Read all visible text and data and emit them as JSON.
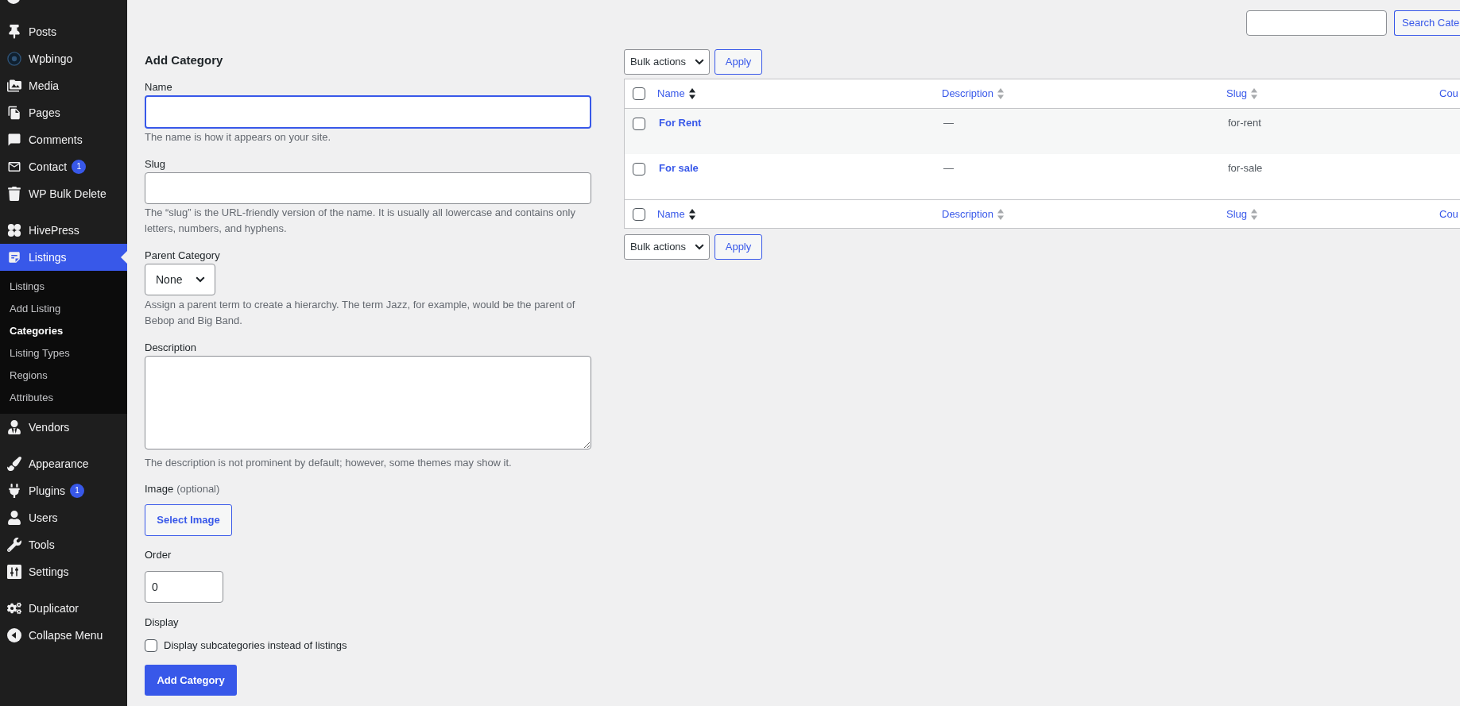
{
  "sidebar": {
    "sections": [
      {
        "items": [
          {
            "label": "Posts",
            "selected": false
          },
          {
            "label": "Wpbingo",
            "selected": false
          },
          {
            "label": "Media",
            "selected": false
          },
          {
            "label": "Pages",
            "selected": false
          },
          {
            "label": "Comments",
            "selected": false
          },
          {
            "label": "Contact",
            "selected": false,
            "badge": "1"
          },
          {
            "label": "WP Bulk Delete",
            "selected": false
          }
        ]
      },
      {
        "items": [
          {
            "label": "HivePress",
            "selected": false
          },
          {
            "label": "Listings",
            "selected": true,
            "children": [
              {
                "label": "Listings",
                "selected": false
              },
              {
                "label": "Add Listing",
                "selected": false
              },
              {
                "label": "Categories",
                "selected": true
              },
              {
                "label": "Listing Types",
                "selected": false
              },
              {
                "label": "Regions",
                "selected": false
              },
              {
                "label": "Attributes",
                "selected": false
              }
            ]
          },
          {
            "label": "Vendors",
            "selected": false
          }
        ]
      },
      {
        "items": [
          {
            "label": "Appearance",
            "selected": false
          },
          {
            "label": "Plugins",
            "selected": false,
            "badge": "1"
          },
          {
            "label": "Users",
            "selected": false
          },
          {
            "label": "Tools",
            "selected": false
          },
          {
            "label": "Settings",
            "selected": false
          }
        ]
      },
      {
        "items": [
          {
            "label": "Duplicator",
            "selected": false
          },
          {
            "label": "Collapse Menu",
            "selected": false
          }
        ]
      }
    ]
  },
  "search": {
    "button": "Search Cate"
  },
  "form": {
    "title": "Add Category",
    "fields": [
      {
        "kind": "text",
        "label": "Name",
        "focused": true,
        "description": "The name is how it appears on your site."
      },
      {
        "kind": "text",
        "label": "Slug",
        "focused": false,
        "description": "The “slug” is the URL-friendly version of the name. It is usually all lowercase and contains only letters, numbers, and hyphens."
      },
      {
        "kind": "select",
        "label": "Parent Category",
        "value": "None",
        "description": "Assign a parent term to create a hierarchy. The term Jazz, for example, would be the parent of Bebop and Big Band."
      },
      {
        "kind": "textarea",
        "label": "Description",
        "description": "The description is not prominent by default; however, some themes may show it."
      },
      {
        "kind": "image",
        "label": "Image",
        "label_note": "(optional)",
        "button": "Select Image"
      },
      {
        "kind": "number",
        "label": "Order",
        "value": "0"
      },
      {
        "kind": "checkbox",
        "label": "Display",
        "option": "Display subcategories instead of listings",
        "checked": false
      }
    ],
    "submit": "Add Category"
  },
  "table": {
    "top_actions": {
      "bulk_select": "Bulk actions",
      "apply": "Apply"
    },
    "header": {
      "checked": false,
      "columns": [
        {
          "label": "Name",
          "sorted": true
        },
        {
          "label": "Description",
          "sorted": false
        },
        {
          "label": "Slug",
          "sorted": false
        },
        {
          "label": "Cou"
        }
      ]
    },
    "rows": [
      {
        "checked": false,
        "name": "For Rent",
        "description": "—",
        "slug": "for-rent"
      },
      {
        "checked": false,
        "name": "For sale",
        "description": "—",
        "slug": "for-sale"
      }
    ],
    "footer": {
      "checked": false,
      "columns": [
        {
          "label": "Name",
          "sorted": true
        },
        {
          "label": "Description",
          "sorted": false
        },
        {
          "label": "Slug",
          "sorted": false
        },
        {
          "label": "Cou"
        }
      ]
    },
    "bottom_actions": {
      "bulk_select": "Bulk actions",
      "apply": "Apply"
    }
  }
}
